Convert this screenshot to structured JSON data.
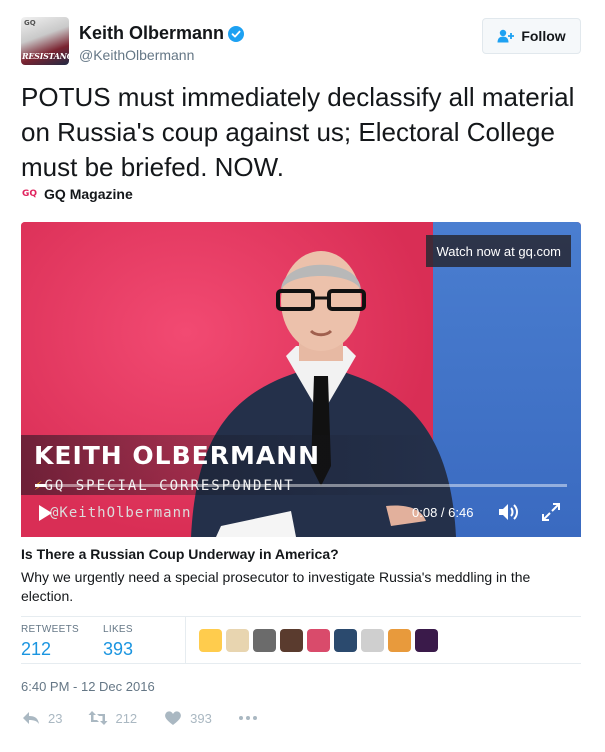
{
  "header": {
    "avatar_text": "GQ",
    "avatar_overlay": "RESISTANCE",
    "display_name": "Keith Olbermann",
    "handle": "@KeithOlbermann",
    "follow_label": "Follow"
  },
  "tweet": {
    "text": "POTUS must immediately declassify all material on Russia's coup against us; Electoral College must be briefed. NOW."
  },
  "source": {
    "logo": "GQ",
    "name": "GQ Magazine"
  },
  "video": {
    "watch_label": "Watch now at gq.com",
    "lower_third_name": "KEITH OLBERMANN",
    "lower_third_title": "GQ SPECIAL CORRESPONDENT",
    "lower_third_handle": "@KeithOlbermann",
    "time": "0:08 / 6:46",
    "progress": 0.02
  },
  "card": {
    "title": "Is There a Russian Coup Underway in America?",
    "description": "Why we urgently need a special prosecutor to investigate Russia's meddling in the election."
  },
  "stats": {
    "retweets_label": "RETWEETS",
    "retweets": "212",
    "likes_label": "LIKES",
    "likes": "393",
    "liker_colors": [
      "#ffcc4d",
      "#e8d5b0",
      "#6b6b6b",
      "#5a3b2e",
      "#d94b6b",
      "#2b4a6e",
      "#cfcfcf",
      "#e89a3c",
      "#3a1a4a"
    ]
  },
  "timestamp": "6:40 PM - 12 Dec 2016",
  "actions": {
    "reply_count": "23",
    "retweet_count": "212",
    "like_count": "393"
  },
  "colors": {
    "accent": "#1b95e0",
    "muted": "#657786",
    "verified": "#1da1f2"
  }
}
